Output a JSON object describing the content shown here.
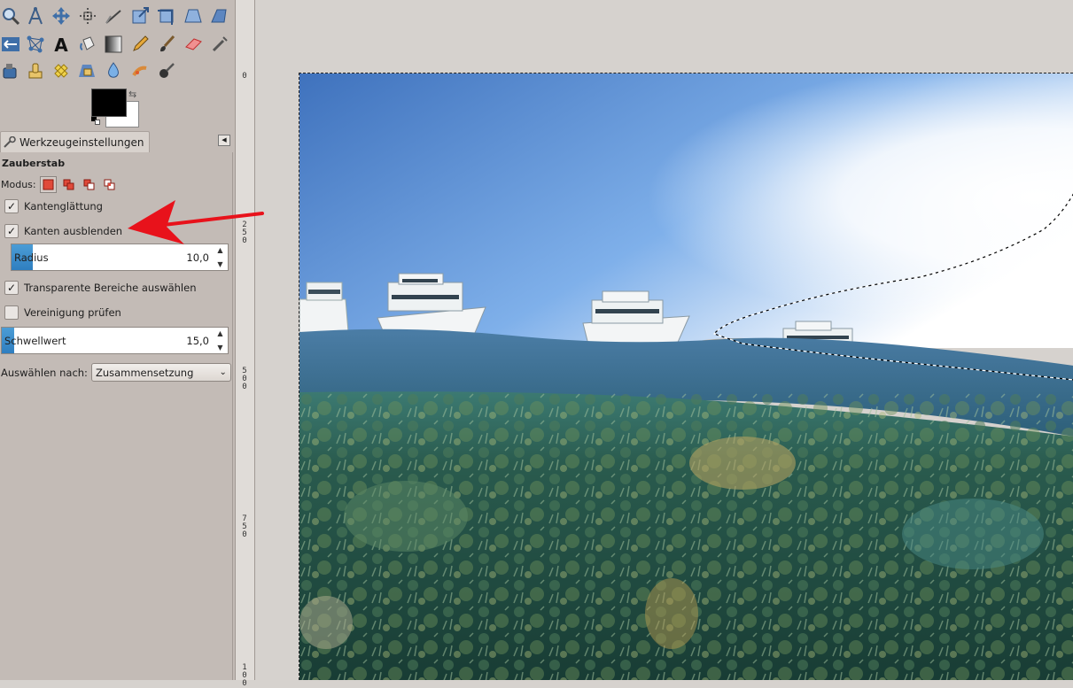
{
  "tool_options": {
    "tab_label": "Werkzeugeinstellungen",
    "tool_name": "Zauberstab",
    "mode_label": "Modus:",
    "antialias_label": "Kantenglättung",
    "antialias_checked": true,
    "feather_label": "Kanten ausblenden",
    "feather_checked": true,
    "radius_label": "Radius",
    "radius_value": "10,0",
    "transparent_label": "Transparente Bereiche auswählen",
    "transparent_checked": true,
    "merged_label": "Vereinigung prüfen",
    "merged_checked": false,
    "threshold_label": "Schwellwert",
    "threshold_value": "15,0",
    "select_by_label": "Auswählen nach:",
    "select_by_value": "Zusammensetzung"
  },
  "ruler": {
    "vertical_labels": [
      "0",
      "250",
      "500",
      "750",
      "100"
    ]
  },
  "colors": {
    "foreground": "#000000",
    "background": "#ffffff",
    "annotation_arrow": "#e8121b"
  },
  "toolbox": {
    "tools": [
      "zoom-icon",
      "paths-icon",
      "move-icon",
      "align-icon",
      "measure-icon",
      "scale-icon",
      "crop-icon",
      "perspective-icon",
      "shear-icon",
      "flip-icon",
      "cage-icon",
      "text-icon",
      "bucket-fill-icon",
      "blend-icon",
      "pencil-icon",
      "paintbrush-icon",
      "eraser-icon",
      "airbrush-icon",
      "ink-icon",
      "clone-icon",
      "heal-icon",
      "perspective-clone-icon",
      "blur-icon",
      "smudge-icon",
      "dodge-burn-icon"
    ]
  }
}
